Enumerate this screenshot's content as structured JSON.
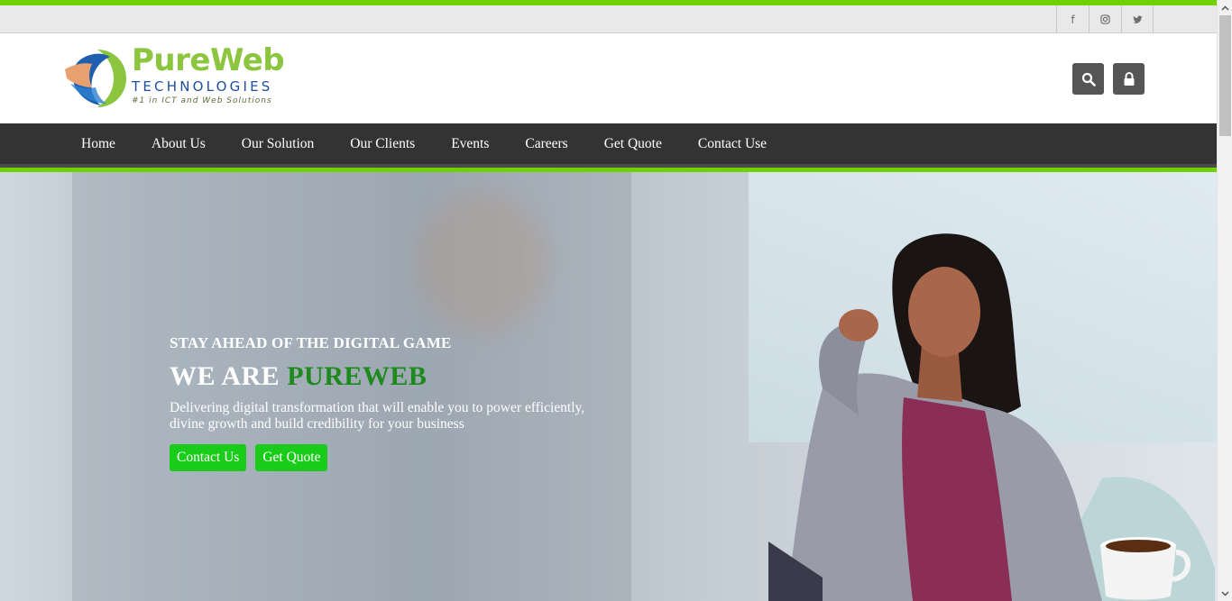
{
  "colors": {
    "accent": "#6fd100",
    "nav_bg": "#333333",
    "cta_bg": "#19cc19",
    "highlight": "#1e8a1e"
  },
  "social": [
    {
      "icon": "facebook-icon",
      "glyph": "f"
    },
    {
      "icon": "instagram-icon",
      "glyph": "◎"
    },
    {
      "icon": "twitter-icon",
      "glyph": "🐦"
    }
  ],
  "logo": {
    "title": "PureWeb",
    "subtitle": "TECHNOLOGIES",
    "tagline": "#1 in ICT and Web Solutions"
  },
  "header_buttons": {
    "search_icon": "search-icon",
    "lock_icon": "lock-icon"
  },
  "nav": {
    "items": [
      "Home",
      "About Us",
      "Our Solution",
      "Our Clients",
      "Events",
      "Careers",
      "Get Quote",
      "Contact Use"
    ]
  },
  "hero": {
    "eyebrow": "STAY AHEAD OF THE DIGITAL GAME",
    "headline_prefix": "WE ARE ",
    "headline_highlight": "PUREWEB",
    "description": "Delivering digital transformation that will enable you to power efficiently, divine growth and build credibility for your business",
    "cta_primary": "Contact Us",
    "cta_secondary": "Get Quote"
  }
}
